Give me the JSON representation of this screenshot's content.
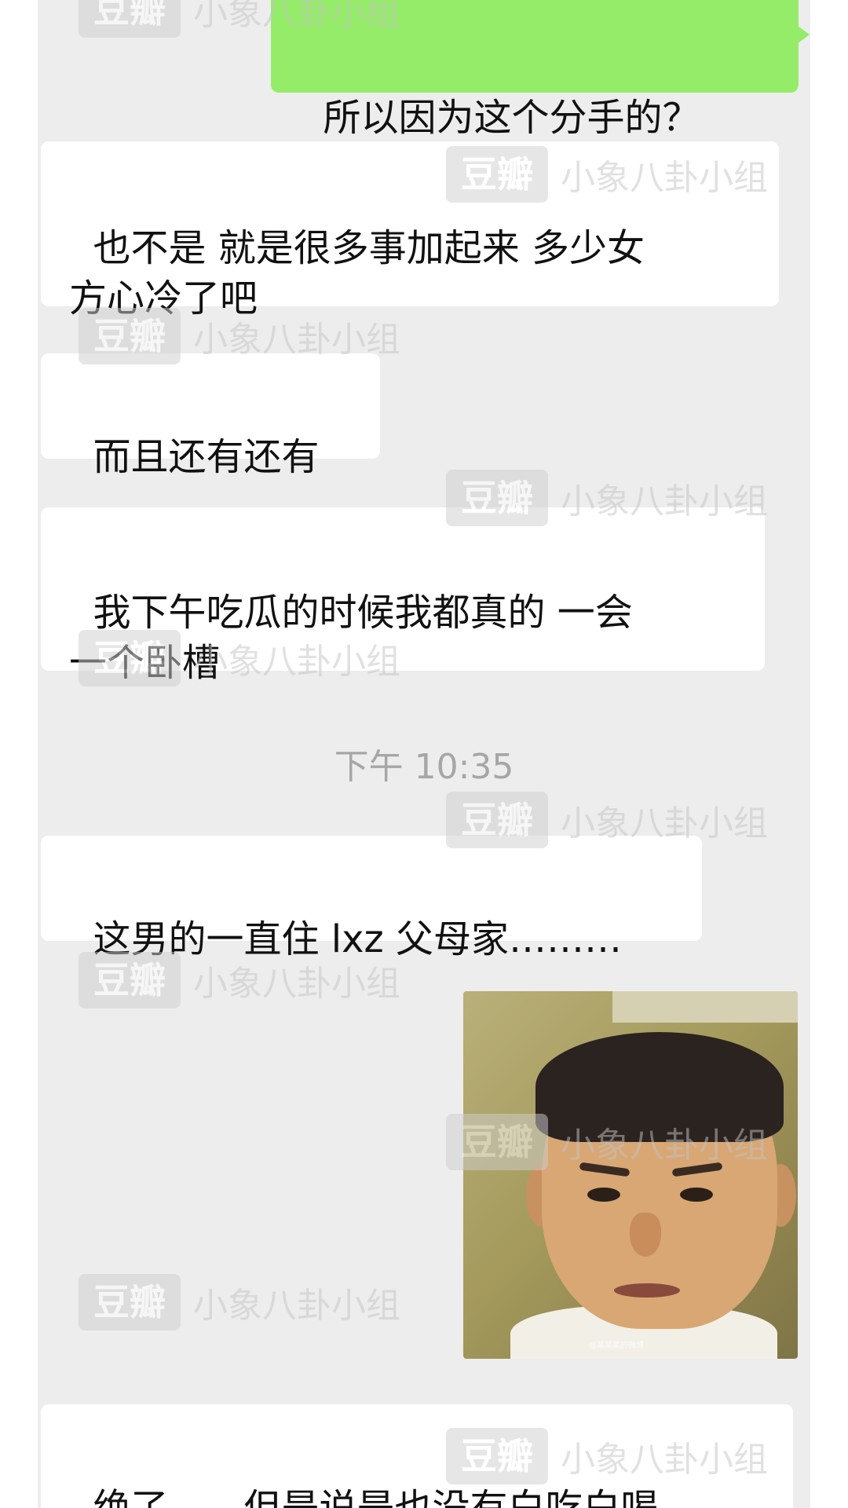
{
  "messages": [
    {
      "side": "out",
      "text": "所以因为这个分手的？"
    },
    {
      "side": "in",
      "text": "也不是 就是很多事加起来 多少女\n方心冷了吧"
    },
    {
      "side": "in",
      "text": "而且还有还有"
    },
    {
      "side": "in",
      "text": "我下午吃瓜的时候我都真的 一会\n一个卧槽"
    },
    {
      "side": "in",
      "text": "这男的一直住 lxz 父母家………"
    },
    {
      "side": "in",
      "text": "绝了……但是说是也没有白吃白喝"
    }
  ],
  "timestamp": "下午 10:35",
  "image_message": {
    "type": "photo",
    "subject": "reaction-face",
    "source_mark": "@某某某的微博"
  },
  "watermark": {
    "logo": "豆瓣",
    "group": "小象八卦小组"
  },
  "colors": {
    "chat_background": "#ededed",
    "incoming_bubble": "#ffffff",
    "outgoing_bubble": "#95ec69",
    "timestamp_text": "#a6a6a6"
  }
}
